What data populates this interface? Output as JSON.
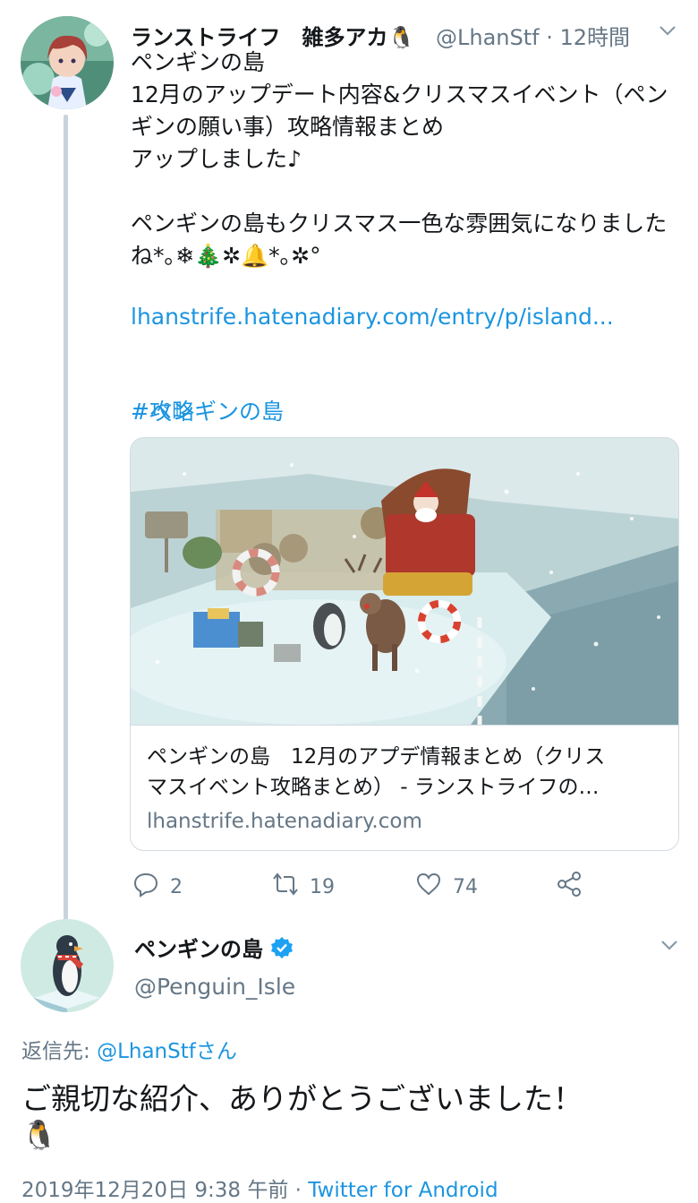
{
  "tweet1": {
    "display_name": "ランストライフ　雑多アカ🐧",
    "handle": "@LhanStf",
    "time": "· 12時間",
    "text": "ペンギンの島\n12月のアップデート内容&クリスマスイベント（ペン\nギンの願い事）攻略情報まとめ\nアップしました♪\n\nペンギンの島もクリスマス一色な雰囲気になりました\nね*｡❄🎄✲🔔*｡✲°",
    "link": "lhanstrife.hatenadiary.com/entry/p/island...",
    "hashtag1": "#ペンギンの島",
    "hashtag2": "#攻略",
    "card": {
      "title": "ペンギンの島　12月のアプデ情報まとめ（クリス\nマスイベント攻略まとめ） - ランストライフの…",
      "domain": "lhanstrife.hatenadiary.com"
    },
    "actions": {
      "replies": "2",
      "retweets": "19",
      "likes": "74"
    }
  },
  "tweet2": {
    "display_name": "ペンギンの島",
    "handle": "@Penguin_Isle",
    "reply_to_prefix": "返信先: ",
    "reply_to_handle": "@LhanStfさん",
    "text": "ご親切な紹介、ありがとうございました！",
    "emoji": "🐧",
    "timestamp": "2019年12月20日 9:38 午前",
    "separator": " · ",
    "source": "Twitter for Android"
  },
  "colors": {
    "link": "#1b95e0",
    "verified": "#1da1f2",
    "muted": "#657786"
  },
  "icons": [
    "chevron-down-icon",
    "reply-icon",
    "retweet-icon",
    "like-icon",
    "share-icon",
    "verified-icon",
    "yin-yang-icon"
  ]
}
